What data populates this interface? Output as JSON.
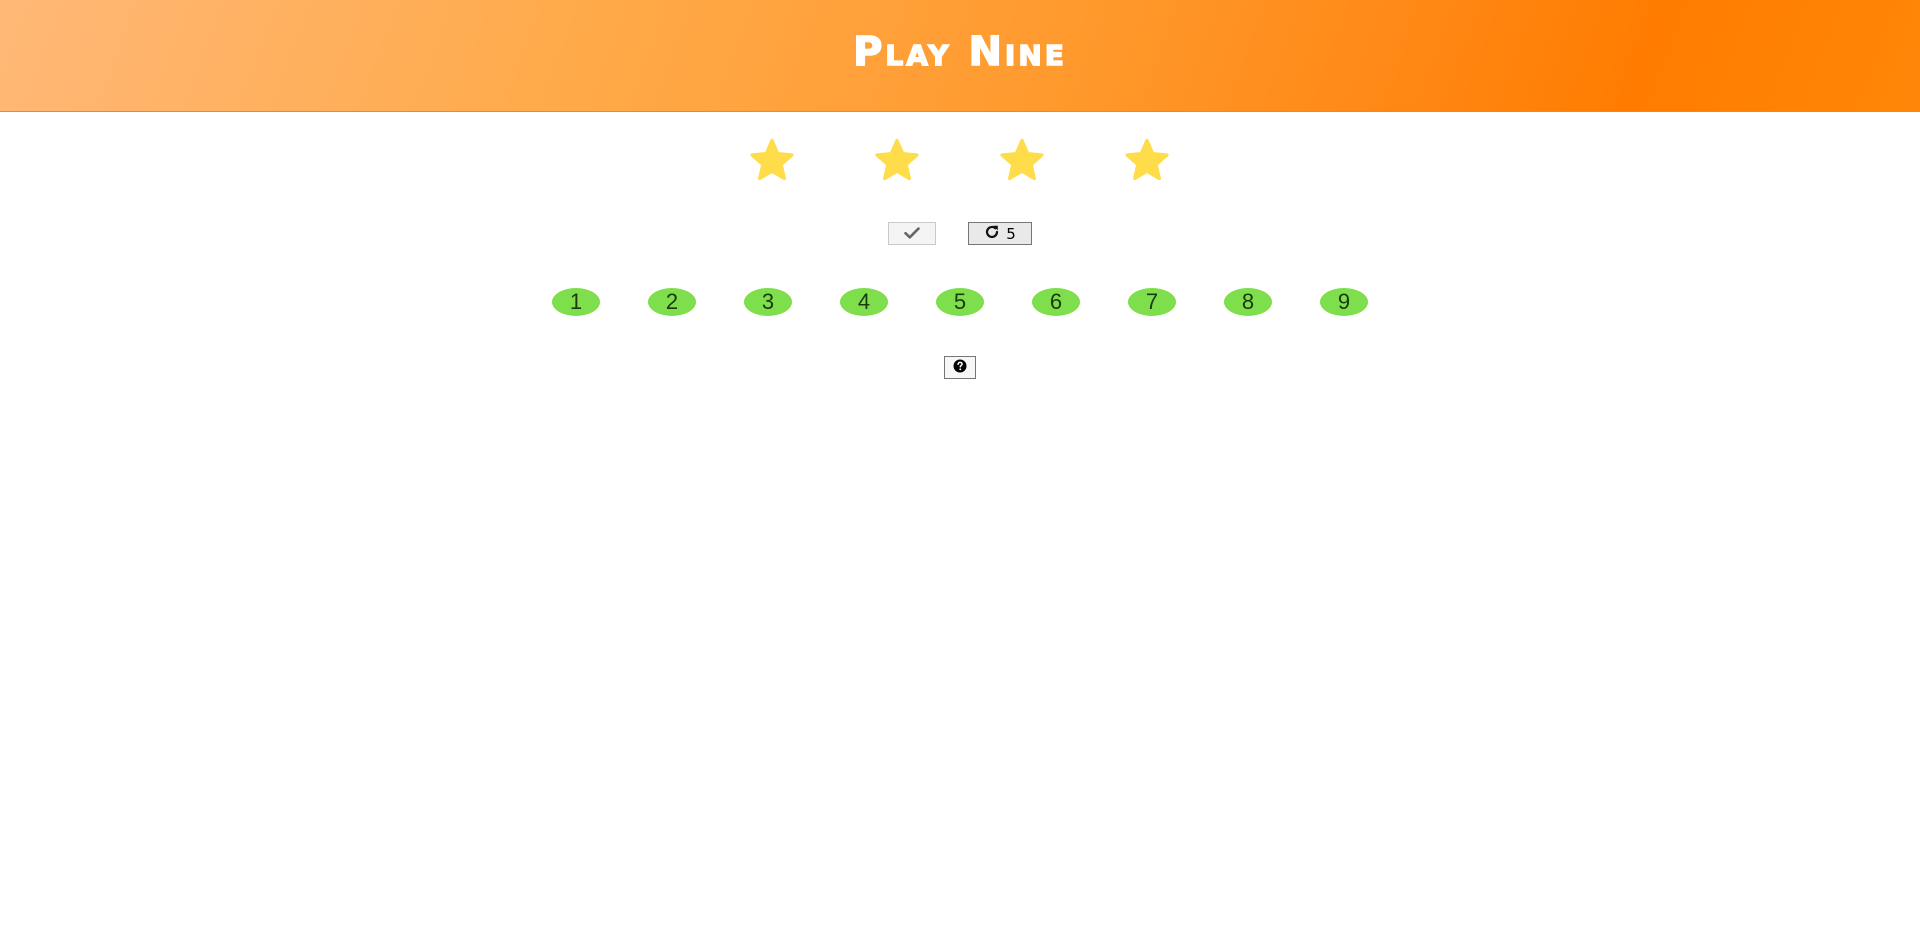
{
  "header": {
    "title": "Play Nine",
    "gradient_start": "#ffb877",
    "gradient_end": "#ff7c00"
  },
  "stars": {
    "count": 4,
    "color": "#ffdc4a",
    "icon": "star-icon"
  },
  "controls": {
    "check_icon": "check-icon",
    "redraw_icon": "redo-icon",
    "redraw_count": "5",
    "help_icon": "question-circle-icon"
  },
  "numbers": {
    "color": "#7ede4c",
    "items": [
      "1",
      "2",
      "3",
      "4",
      "5",
      "6",
      "7",
      "8",
      "9"
    ]
  }
}
